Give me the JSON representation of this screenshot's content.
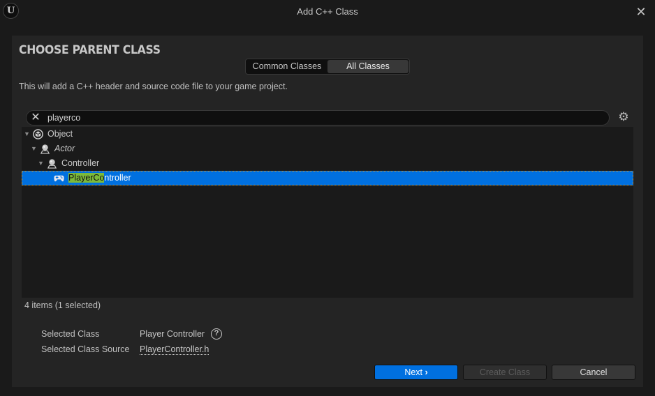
{
  "window": {
    "title": "Add C++ Class",
    "logo_icon": "unreal-engine-logo-icon",
    "close_icon": "close-icon"
  },
  "panel": {
    "heading": "CHOOSE PARENT CLASS",
    "tabs": [
      {
        "label": "Common Classes",
        "active": false
      },
      {
        "label": "All Classes",
        "active": true
      }
    ],
    "description": "This will add a C++ header and source code file to your game project."
  },
  "search": {
    "value": "playerco",
    "placeholder": "",
    "clear_icon": "clear-x-icon",
    "settings_icon": "gear-icon"
  },
  "tree": {
    "items": [
      {
        "label": "Object",
        "icon": "object-icon",
        "expanded": true,
        "italic": false,
        "depth": 0
      },
      {
        "label": "Actor",
        "icon": "actor-icon",
        "expanded": true,
        "italic": true,
        "depth": 1
      },
      {
        "label": "Controller",
        "icon": "actor-icon",
        "expanded": true,
        "italic": false,
        "depth": 2
      },
      {
        "label": "PlayerController",
        "label_match": "PlayerCo",
        "label_rest": "ntroller",
        "icon": "gamepad-icon",
        "selected": true,
        "depth": 3
      }
    ],
    "highlight_color": "#7cba3a",
    "selection_color": "#0070e0"
  },
  "status": {
    "count": "4 items (1 selected)"
  },
  "info": {
    "selected_class_label": "Selected Class",
    "selected_class_value": "Player Controller",
    "selected_source_label": "Selected Class Source",
    "selected_source_value": "PlayerController.h"
  },
  "buttons": {
    "next": "Next",
    "create": "Create Class",
    "cancel": "Cancel"
  }
}
